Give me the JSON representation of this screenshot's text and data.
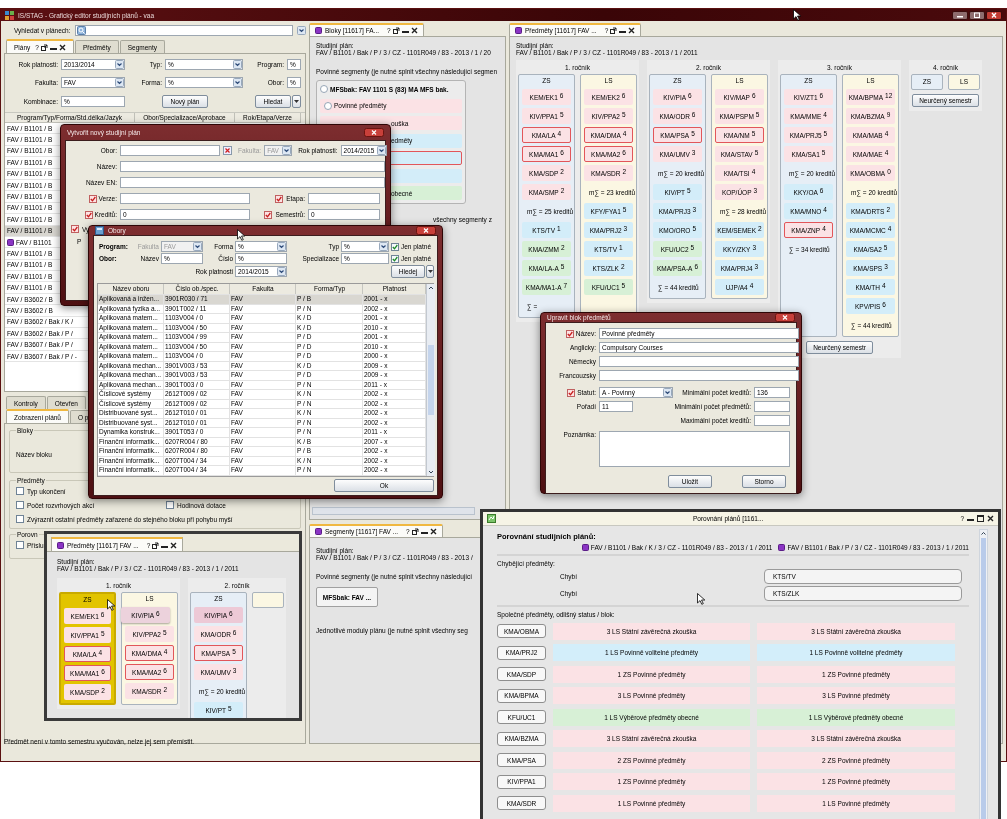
{
  "window": {
    "title": "IS/STAG - Grafický editor studijních plánů - vaa"
  },
  "plans_panel": {
    "search_label": "Vyhledat v plánech:",
    "tabs": [
      {
        "label": "Plány",
        "selected": true,
        "help": "?"
      },
      {
        "label": "Předměty",
        "selected": false
      },
      {
        "label": "Segmenty",
        "selected": false
      }
    ],
    "filters": [
      {
        "label": "Rok platnosti:",
        "value": "2013/2014",
        "kind": "select"
      },
      {
        "label": "Typ:",
        "value": "%",
        "kind": "select"
      },
      {
        "label": "Program:",
        "value": "%",
        "kind": "text"
      },
      {
        "label": "Fakulta:",
        "value": "FAV",
        "kind": "select"
      },
      {
        "label": "Forma:",
        "value": "%",
        "kind": "select"
      },
      {
        "label": "Obor:",
        "value": "%",
        "kind": "text"
      },
      {
        "label": "Kombinace:",
        "value": "%",
        "kind": "text"
      }
    ],
    "new_plan_button": "Nový plán",
    "search_button": "Hledat",
    "columns": [
      "Program/Typ/Forma/Std.délka/Jazyk",
      "Obor/Specializace/Aprobace",
      "Rok/Etapa/Verze"
    ],
    "rows": [
      {
        "text": "FAV / B1101 / B",
        "selected": false,
        "kind": "plain"
      },
      {
        "text": "FAV / B1101 / B",
        "selected": false,
        "kind": "plain"
      },
      {
        "text": "FAV / B1101 / B",
        "selected": false,
        "kind": "plain"
      },
      {
        "text": "FAV / B1101 / B",
        "selected": false,
        "kind": "plain"
      },
      {
        "text": "FAV / B1101 / B",
        "selected": false,
        "kind": "plain"
      },
      {
        "text": "FAV / B1101 / B",
        "selected": false,
        "kind": "plain"
      },
      {
        "text": "FAV / B1101 / B",
        "selected": false,
        "kind": "plain"
      },
      {
        "text": "FAV / B1101 / B",
        "selected": false,
        "kind": "plain"
      },
      {
        "text": "FAV / B1101 / B",
        "selected": false,
        "kind": "plain"
      },
      {
        "text": "FAV / B1101 / B",
        "selected": true,
        "kind": "plain"
      },
      {
        "text": "FAV / B1101",
        "selected": false,
        "kind": "open"
      },
      {
        "text": "FAV / B1101 / B",
        "selected": false,
        "kind": "plain"
      },
      {
        "text": "FAV / B1101 / B",
        "selected": false,
        "kind": "plain"
      },
      {
        "text": "FAV / B1101 / B",
        "selected": false,
        "kind": "plain"
      },
      {
        "text": "FAV / B1101 / B",
        "selected": false,
        "kind": "plain"
      },
      {
        "text": "FAV / B3602 / B",
        "selected": false,
        "kind": "plain"
      },
      {
        "text": "FAV / B3602 / B",
        "selected": false,
        "kind": "plain"
      },
      {
        "text": "FAV / B3602 / Bak / K /",
        "selected": false,
        "kind": "plain"
      },
      {
        "text": "FAV / B3602 / Bak / P /",
        "selected": false,
        "kind": "plain"
      },
      {
        "text": "FAV / B3607 / Bak / P /",
        "selected": false,
        "kind": "plain"
      },
      {
        "text": "FAV / B3607 / Bak / P / -",
        "selected": false,
        "kind": "plain"
      }
    ]
  },
  "options_panel": {
    "back_tabs": [
      {
        "label": "Kontroly",
        "selected": false
      },
      {
        "label": "Otevřen",
        "selected": false
      }
    ],
    "front_tabs": [
      {
        "label": "Zobrazení plánů",
        "selected": true
      },
      {
        "label": "O p",
        "selected": false
      }
    ],
    "blocks_group": {
      "title": "Bloky",
      "label": "Název bloku"
    },
    "subjects_group": {
      "title": "Předměty",
      "options": [
        {
          "label": "Typ ukončení",
          "checked": false
        },
        {
          "label": "Počet rozvrhových akcí",
          "checked": false
        },
        {
          "label": "Hodinová dotace",
          "checked": false
        },
        {
          "label": "Zvýraznit ostatní předměty zařazené do stejného bloku při pohybu myší",
          "checked": false
        }
      ]
    },
    "compare_group": {
      "title": "Porovn",
      "options": [
        {
          "label": "Příslu",
          "checked": false
        }
      ]
    }
  },
  "blocks_panel": {
    "tab": {
      "label": "Bloky [11617] FA...",
      "help": "?"
    },
    "plan_label": "Studijní plán:",
    "plan": "FAV / B1101 / Bak / P / 3 / CZ - 1101R049 / 83 - 2013 / 1 / 20",
    "mandatory_label": "Povinné segmenty (je nutné splnit všechny následující segmen",
    "segment": {
      "title": "MFSbak: FAV 1101 S (83) MA MFS bak.",
      "selected": false
    },
    "first_block": {
      "text": "Povinné předměty",
      "selected": false
    },
    "blocks": [
      {
        "text": "ouška",
        "kind": "p",
        "flagged": false
      },
      {
        "text": "edměty",
        "kind": "pv",
        "flagged": false
      },
      {
        "kind": "pv",
        "flagged": true
      },
      {
        "kind": "pv",
        "flagged": false
      },
      {
        "text": "obecné",
        "kind": "v",
        "flagged": false
      }
    ],
    "modules_label": "všechny segmenty z"
  },
  "segments_panel": {
    "tab": {
      "label": "Segmenty [11617] FAV ...",
      "help": "?"
    },
    "plan_label": "Studijní plán:",
    "plan": "FAV / B1101 / Bak / P / 3 / CZ - 1101R049 / 83 - 2013 /",
    "mandatory_label": "Povinné segmenty (je nutné splnit všechny následující",
    "segment": "MFSbak: FAV ...",
    "modules_label": "Jednotlivé moduly plánu (je nutné splnit všechny seg"
  },
  "subjects_panel": {
    "tab": {
      "label": "Předměty [11617] FAV ...",
      "help": "?"
    },
    "plan_label": "Studijní plán:",
    "plan": "FAV / B1101 / Bak / P / 3 / CZ - 1101R049 / 83 - 2013 / 1 / 2011",
    "years": [
      {
        "label": "1. ročník",
        "semesters": [
          {
            "label": "ZS",
            "kind": "zs",
            "highlighted": false,
            "items": [
              {
                "code": "KEM/EK1",
                "credits": "6",
                "kind": "p",
                "flagged": false
              },
              {
                "code": "KIV/PPA1",
                "credits": "5",
                "kind": "p",
                "flagged": false
              },
              {
                "code": "KMA/LA",
                "credits": "4",
                "kind": "p",
                "flagged": true
              },
              {
                "code": "KMA/MA1",
                "credits": "6",
                "kind": "p",
                "flagged": true
              },
              {
                "code": "KMA/SDP",
                "credits": "2",
                "kind": "p",
                "flagged": false
              },
              {
                "code": "KMA/SMP",
                "credits": "2",
                "kind": "p",
                "flagged": false
              },
              {
                "text": "m∑ = 25 kreditů",
                "kind": "sum",
                "flagged": false
              },
              {
                "code": "KTS/TV",
                "credits": "1",
                "kind": "pv",
                "flagged": false
              },
              {
                "code": "KMA/ZMM",
                "credits": "2",
                "kind": "v",
                "flagged": false
              },
              {
                "code": "KMA/LA-A",
                "credits": "5",
                "kind": "v",
                "flagged": false
              },
              {
                "code": "KMA/MA1-A",
                "credits": "7",
                "kind": "v",
                "flagged": false
              },
              {
                "text": "∑ =",
                "kind": "sum",
                "flagged": false
              }
            ]
          },
          {
            "label": "LS",
            "kind": "ls",
            "highlighted": false,
            "items": [
              {
                "code": "KEM/EK2",
                "credits": "6",
                "kind": "p",
                "flagged": false
              },
              {
                "code": "KIV/PPA2",
                "credits": "5",
                "kind": "p",
                "flagged": false
              },
              {
                "code": "KMA/DMA",
                "credits": "4",
                "kind": "p",
                "flagged": true
              },
              {
                "code": "KMA/MA2",
                "credits": "6",
                "kind": "p",
                "flagged": true
              },
              {
                "code": "KMA/SDR",
                "credits": "2",
                "kind": "p",
                "flagged": false
              },
              {
                "text": "m∑ = 23 kreditů",
                "kind": "sum",
                "flagged": false
              },
              {
                "code": "KFY/FYA1",
                "credits": "5",
                "kind": "pv",
                "flagged": false
              },
              {
                "code": "KMA/PRJ2",
                "credits": "3",
                "kind": "pv",
                "flagged": false
              },
              {
                "code": "KTS/TV",
                "credits": "1",
                "kind": "pv",
                "flagged": false
              },
              {
                "code": "KTS/ZLK",
                "credits": "2",
                "kind": "pv",
                "flagged": false
              },
              {
                "code": "KFU/UC1",
                "credits": "5",
                "kind": "v",
                "flagged": false
              }
            ]
          }
        ]
      },
      {
        "label": "2. ročník",
        "semesters": [
          {
            "label": "ZS",
            "kind": "zs",
            "highlighted": false,
            "items": [
              {
                "code": "KIV/PIA",
                "credits": "6",
                "kind": "p",
                "flagged": false
              },
              {
                "code": "KMA/ODR",
                "credits": "6",
                "kind": "p",
                "flagged": false
              },
              {
                "code": "KMA/PSA",
                "credits": "5",
                "kind": "p",
                "flagged": true
              },
              {
                "code": "KMA/UMV",
                "credits": "3",
                "kind": "p",
                "flagged": false
              },
              {
                "text": "m∑ = 20 kreditů",
                "kind": "sum",
                "flagged": false
              },
              {
                "code": "KIV/PT",
                "credits": "5",
                "kind": "pv",
                "flagged": false
              },
              {
                "code": "KMA/PRJ3",
                "credits": "3",
                "kind": "pv",
                "flagged": false
              },
              {
                "code": "KMO/ORO",
                "credits": "5",
                "kind": "pv",
                "flagged": false
              },
              {
                "code": "KFU/UC2",
                "credits": "5",
                "kind": "v",
                "flagged": false
              },
              {
                "code": "KMA/PSA-A",
                "credits": "6",
                "kind": "v",
                "flagged": false
              },
              {
                "text": "∑ = 44 kreditů",
                "kind": "sum",
                "flagged": false
              }
            ]
          },
          {
            "label": "LS",
            "kind": "ls",
            "highlighted": false,
            "items": [
              {
                "code": "KIV/MAP",
                "credits": "6",
                "kind": "p",
                "flagged": false
              },
              {
                "code": "KMA/PSPM",
                "credits": "5",
                "kind": "p",
                "flagged": false
              },
              {
                "code": "KMA/NM",
                "credits": "5",
                "kind": "p",
                "flagged": true
              },
              {
                "code": "KMA/STAV",
                "credits": "5",
                "kind": "p",
                "flagged": false
              },
              {
                "code": "KMA/TSI",
                "credits": "4",
                "kind": "p",
                "flagged": false
              },
              {
                "code": "KOP/ÚOP",
                "credits": "3",
                "kind": "p",
                "flagged": false
              },
              {
                "text": "m∑ = 28 kreditů",
                "kind": "sum",
                "flagged": false
              },
              {
                "code": "KEM/SEMEK",
                "credits": "2",
                "kind": "pv",
                "flagged": false
              },
              {
                "code": "KKY/ZKY",
                "credits": "3",
                "kind": "pv",
                "flagged": false
              },
              {
                "code": "KMA/PRJ4",
                "credits": "3",
                "kind": "pv",
                "flagged": false
              },
              {
                "code": "UJP/A4",
                "credits": "4",
                "kind": "pv",
                "flagged": false
              }
            ]
          }
        ]
      },
      {
        "label": "3. ročník",
        "undetermined": "Neurčený semestr",
        "semesters": [
          {
            "label": "ZS",
            "kind": "zs",
            "highlighted": false,
            "items": [
              {
                "code": "KIV/ZT1",
                "credits": "6",
                "kind": "p",
                "flagged": false
              },
              {
                "code": "KMA/MME",
                "credits": "4",
                "kind": "p",
                "flagged": false
              },
              {
                "code": "KMA/PRJ5",
                "credits": "5",
                "kind": "p",
                "flagged": false
              },
              {
                "code": "KMA/SA1",
                "credits": "5",
                "kind": "p",
                "flagged": false
              },
              {
                "text": "m∑ = 20 kreditů",
                "kind": "sum",
                "flagged": false
              },
              {
                "code": "KKY/OA",
                "credits": "6",
                "kind": "pv",
                "flagged": false
              },
              {
                "code": "KMA/MNO",
                "credits": "4",
                "kind": "pv",
                "flagged": false
              },
              {
                "code": "KMA/ZNP",
                "credits": "4",
                "kind": "p",
                "flagged": true
              },
              {
                "text": "∑ = 34 kreditů",
                "kind": "sum",
                "flagged": false
              }
            ]
          },
          {
            "label": "LS",
            "kind": "ls",
            "highlighted": false,
            "items": [
              {
                "code": "KMA/BPMA",
                "credits": "12",
                "kind": "p",
                "flagged": false
              },
              {
                "code": "KMA/BZMA",
                "credits": "9",
                "kind": "p",
                "flagged": false
              },
              {
                "code": "KMA/MAB",
                "credits": "4",
                "kind": "p",
                "flagged": false
              },
              {
                "code": "KMA/MAE",
                "credits": "4",
                "kind": "p",
                "flagged": false
              },
              {
                "code": "KMA/OBMA",
                "credits": "0",
                "kind": "p",
                "flagged": false
              },
              {
                "text": "m∑ = 20 kreditů",
                "kind": "sum",
                "flagged": false
              },
              {
                "code": "KMA/DRTS",
                "credits": "2",
                "kind": "pv",
                "flagged": false
              },
              {
                "code": "KMA/MCMC",
                "credits": "4",
                "kind": "pv",
                "flagged": false
              },
              {
                "code": "KMA/SA2",
                "credits": "5",
                "kind": "pv",
                "flagged": false
              },
              {
                "code": "KMA/SPS",
                "credits": "3",
                "kind": "pv",
                "flagged": false
              },
              {
                "code": "KMA/TH",
                "credits": "4",
                "kind": "pv",
                "flagged": false
              },
              {
                "code": "KPV/PIS",
                "credits": "6",
                "kind": "pv",
                "flagged": false
              },
              {
                "text": "∑ = 44 kreditů",
                "kind": "sum",
                "flagged": false
              }
            ]
          }
        ]
      },
      {
        "label": "4. ročník",
        "undetermined": "Neurčený semestr",
        "semesters": [
          {
            "label": "ZS",
            "kind": "zs",
            "highlighted": false
          },
          {
            "label": "LS",
            "kind": "ls",
            "highlighted": false
          }
        ]
      }
    ]
  },
  "status_bar": "Předmět není v tomto semestru vyučován, nelze jej sem přemístit.",
  "create_dialog": {
    "title": "Vytvořit nový studijní plán",
    "obor": {
      "label": "Obor:"
    },
    "faculty": {
      "label": "Fakulta:",
      "value": "FAV",
      "disabled": true
    },
    "year": {
      "label": "Rok platnosti:",
      "value": "2014/2015"
    },
    "name": {
      "label": "Název:"
    },
    "name_en": {
      "label": "Název EN:"
    },
    "version": {
      "label": "Verze:",
      "checked": true
    },
    "stage": {
      "label": "Etapa:",
      "checked": true
    },
    "credits": {
      "label": "Kreditů:",
      "value": "0",
      "checked": true
    },
    "semesters": {
      "label": "Semestrů:",
      "value": "0",
      "checked": true
    },
    "checkbox_6": {
      "label": "Vy",
      "checked": true
    },
    "label_7": "P"
  },
  "obory_dialog": {
    "title": "Obory",
    "program_label": "Program:",
    "faculty": {
      "label": "Fakulta",
      "value": "FAV",
      "disabled": true
    },
    "form": {
      "label": "Forma",
      "value": "%"
    },
    "type": {
      "label": "Typ",
      "value": "%"
    },
    "valid_1": {
      "label": "Jen platné",
      "checked": true
    },
    "obor_label": "Obor:",
    "name": {
      "label": "Název",
      "value": "%"
    },
    "number": {
      "label": "Číslo",
      "value": "%"
    },
    "specialization": {
      "label": "Specializace",
      "value": "%"
    },
    "valid_2": {
      "label": "Jen platné",
      "checked": true
    },
    "year": {
      "label": "Rok platnosti",
      "value": "2014/2015"
    },
    "search_button": "Hledej",
    "columns": [
      "Název oboru",
      "Číslo ob./spec.",
      "Fakulta",
      "Forma/Typ",
      "Platnost"
    ],
    "rows": [
      {
        "cells": [
          "Aplikovaná a inžen...",
          "3901R030 / 71",
          "FAV",
          "P / B",
          "2001 - x"
        ],
        "selected": true
      },
      {
        "cells": [
          "Aplikovaná fyzika a...",
          "3901T002 / 11",
          "FAV",
          "P / N",
          "2002 - x"
        ],
        "selected": false
      },
      {
        "cells": [
          "Aplikovaná matem...",
          "1103V004 / 0",
          "FAV",
          "K / D",
          "2001 - x"
        ],
        "selected": false
      },
      {
        "cells": [
          "Aplikovaná matem...",
          "1103V004 / 50",
          "FAV",
          "K / D",
          "2010 - x"
        ],
        "selected": false
      },
      {
        "cells": [
          "Aplikovaná matem...",
          "1103V004 / 99",
          "FAV",
          "P / D",
          "2001 - x"
        ],
        "selected": false
      },
      {
        "cells": [
          "Aplikovaná matem...",
          "1103V004 / 50",
          "FAV",
          "P / D",
          "2010 - x"
        ],
        "selected": false
      },
      {
        "cells": [
          "Aplikovaná matem...",
          "1103V004 / 0",
          "FAV",
          "P / D",
          "2000 - x"
        ],
        "selected": false
      },
      {
        "cells": [
          "Aplikovaná mechan...",
          "3901V003 / 53",
          "FAV",
          "K / D",
          "2009 - x"
        ],
        "selected": false
      },
      {
        "cells": [
          "Aplikovaná mechan...",
          "3901V003 / 53",
          "FAV",
          "P / D",
          "2009 - x"
        ],
        "selected": false
      },
      {
        "cells": [
          "Aplikovaná mechan...",
          "3901T003 / 0",
          "FAV",
          "P / N",
          "2011 - x"
        ],
        "selected": false
      },
      {
        "cells": [
          "Číslicové systémy",
          "2612T009 / 02",
          "FAV",
          "K / N",
          "2002 - x"
        ],
        "selected": false
      },
      {
        "cells": [
          "Číslicové systémy",
          "2612T009 / 02",
          "FAV",
          "P / N",
          "2002 - x"
        ],
        "selected": false
      },
      {
        "cells": [
          "Distribuované syst...",
          "2612T010 / 01",
          "FAV",
          "K / N",
          "2002 - x"
        ],
        "selected": false
      },
      {
        "cells": [
          "Distribuované syst...",
          "2612T010 / 01",
          "FAV",
          "P / N",
          "2002 - x"
        ],
        "selected": false
      },
      {
        "cells": [
          "Dynamika konstruk...",
          "3901T053 / 0",
          "FAV",
          "P / N",
          "2011 - x"
        ],
        "selected": false
      },
      {
        "cells": [
          "Finanční informatik...",
          "6207R004 / 80",
          "FAV",
          "K / B",
          "2007 - x"
        ],
        "selected": false
      },
      {
        "cells": [
          "Finanční informatik...",
          "6207R004 / 80",
          "FAV",
          "P / B",
          "2002 - x"
        ],
        "selected": false
      },
      {
        "cells": [
          "Finanční informatik...",
          "6207T004 / 34",
          "FAV",
          "K / N",
          "2002 - x"
        ],
        "selected": false
      },
      {
        "cells": [
          "Finanční informatik...",
          "6207T004 / 34",
          "FAV",
          "P / N",
          "2002 - x"
        ],
        "selected": false
      }
    ],
    "ok_button": "Ok"
  },
  "block_dialog": {
    "title": "Upravit blok předmětů",
    "name": {
      "label": "Název:",
      "value": "Povinné předměty",
      "checked": true
    },
    "english": {
      "label": "Anglicky:",
      "value": "Compulsory Courses"
    },
    "german": {
      "label": "Německy"
    },
    "french": {
      "label": "Francouzsky"
    },
    "status": {
      "label": "Statut:",
      "value": "A - Povinný",
      "checked": true
    },
    "order": {
      "label": "Pořadí",
      "value": "11"
    },
    "min_credits": {
      "label": "Minimální počet kreditů:",
      "value": "136"
    },
    "min_subjects": {
      "label": "Minimální počet předmětů:"
    },
    "max_credits": {
      "label": "Maximální počet kreditů:"
    },
    "note": {
      "label": "Poznámka:"
    },
    "buttons": [
      "Uložit",
      "Storno"
    ]
  },
  "mini_window": {
    "tab": {
      "label": "Předměty [11617] FAV ...",
      "help": "?"
    },
    "plan_label": "Studijní plán:",
    "plan": "FAV / B1101 / Bak / P / 3 / CZ - 1101R049 / 83 - 2013 / 1 / 2011",
    "years": [
      {
        "label": "1. ročník",
        "semesters": [
          {
            "label": "ZS",
            "kind": "zs",
            "highlighted": true,
            "items": [
              {
                "code": "KEM/EK1",
                "credits": "6",
                "kind": "p",
                "flagged": false
              },
              {
                "code": "KIV/PPA1",
                "credits": "5",
                "kind": "p",
                "flagged": false
              },
              {
                "code": "KMA/LA",
                "credits": "4",
                "kind": "p",
                "flagged": true
              },
              {
                "code": "KMA/MA1",
                "credits": "6",
                "kind": "p",
                "flagged": true
              },
              {
                "code": "KMA/SDP",
                "credits": "2",
                "kind": "p",
                "flagged": false
              }
            ]
          },
          {
            "label": "LS",
            "kind": "ls",
            "highlighted": false,
            "items": [
              {
                "code": "KIV/PIA",
                "credits": "6",
                "kind": "ghost",
                "flagged": false
              },
              {
                "code": "KIV/PPA2",
                "credits": "5",
                "kind": "p",
                "flagged": false
              },
              {
                "code": "KMA/DMA",
                "credits": "4",
                "kind": "p",
                "flagged": true
              },
              {
                "code": "KMA/MA2",
                "credits": "6",
                "kind": "p",
                "flagged": true
              },
              {
                "code": "KMA/SDR",
                "credits": "2",
                "kind": "p",
                "flagged": false
              }
            ]
          }
        ]
      },
      {
        "label": "2. ročník",
        "semesters": [
          {
            "label": "ZS",
            "kind": "zs",
            "highlighted": false,
            "items": [
              {
                "code": "KIV/PIA",
                "credits": "6",
                "kind": "source",
                "flagged": false
              },
              {
                "code": "KMA/ODR",
                "credits": "6",
                "kind": "p",
                "flagged": false
              },
              {
                "code": "KMA/PSA",
                "credits": "5",
                "kind": "p",
                "flagged": true
              },
              {
                "code": "KMA/UMV",
                "credits": "3",
                "kind": "p",
                "flagged": false
              },
              {
                "text": "m∑ = 20 kreditů",
                "kind": "sum",
                "flagged": false
              },
              {
                "code": "KIV/PT",
                "credits": "5",
                "kind": "pv",
                "flagged": false
              }
            ]
          },
          {
            "kind": "ls",
            "highlighted": false
          }
        ]
      }
    ]
  },
  "compare_window": {
    "title": "Porovnání plánů [1161...",
    "help": "?",
    "heading": "Porovnání studijních plánů:",
    "plans": [
      "FAV / B1101 / Bak / K / 3 / CZ - 1101R049 / 83 - 2013 / 1 / 2011",
      "FAV / B1101 / Bak / P / 3 / CZ - 1101R049 / 83 - 2013 / 1 / 2011"
    ],
    "missing_label": "Chybějící předměty:",
    "missing": [
      {
        "label": "Chybí",
        "code": "KTS/TV"
      },
      {
        "label": "Chybí",
        "code": "KTS/ZLK"
      }
    ],
    "common_label": "Společné předměty, odlišný status / blok:",
    "common": [
      {
        "code": "KMA/OBMA",
        "left": "3 LS Státní závěrečná zkouška",
        "right": "3 LS Státní závěrečná zkouška",
        "kind": "p"
      },
      {
        "code": "KMA/PRJ2",
        "left": "1 LS Povinně volitelné předměty",
        "right": "1 LS Povinně volitelné předměty",
        "kind": "pv"
      },
      {
        "code": "KMA/SDP",
        "left": "1 ZS Povinné předměty",
        "right": "1 ZS Povinné předměty",
        "kind": "p"
      },
      {
        "code": "KMA/BPMA",
        "left": "3 LS Povinné předměty",
        "right": "3 LS Povinné předměty",
        "kind": "p"
      },
      {
        "code": "KFU/UC1",
        "left": "1 LS Výběrové předměty obecné",
        "right": "1 LS Výběrové předměty obecné",
        "kind": "v"
      },
      {
        "code": "KMA/BZMA",
        "left": "3 LS Státní závěrečná zkouška",
        "right": "3 LS Státní závěrečná zkouška",
        "kind": "p"
      },
      {
        "code": "KMA/PSA",
        "left": "2 ZS Povinné předměty",
        "right": "2 ZS Povinné předměty",
        "kind": "p"
      },
      {
        "code": "KIV/PPA1",
        "left": "1 ZS Povinné předměty",
        "right": "1 ZS Povinné předměty",
        "kind": "p"
      },
      {
        "code": "KMA/SDR",
        "left": "1 LS Povinné předměty",
        "right": "1 LS Povinné předměty",
        "kind": "p"
      }
    ]
  }
}
